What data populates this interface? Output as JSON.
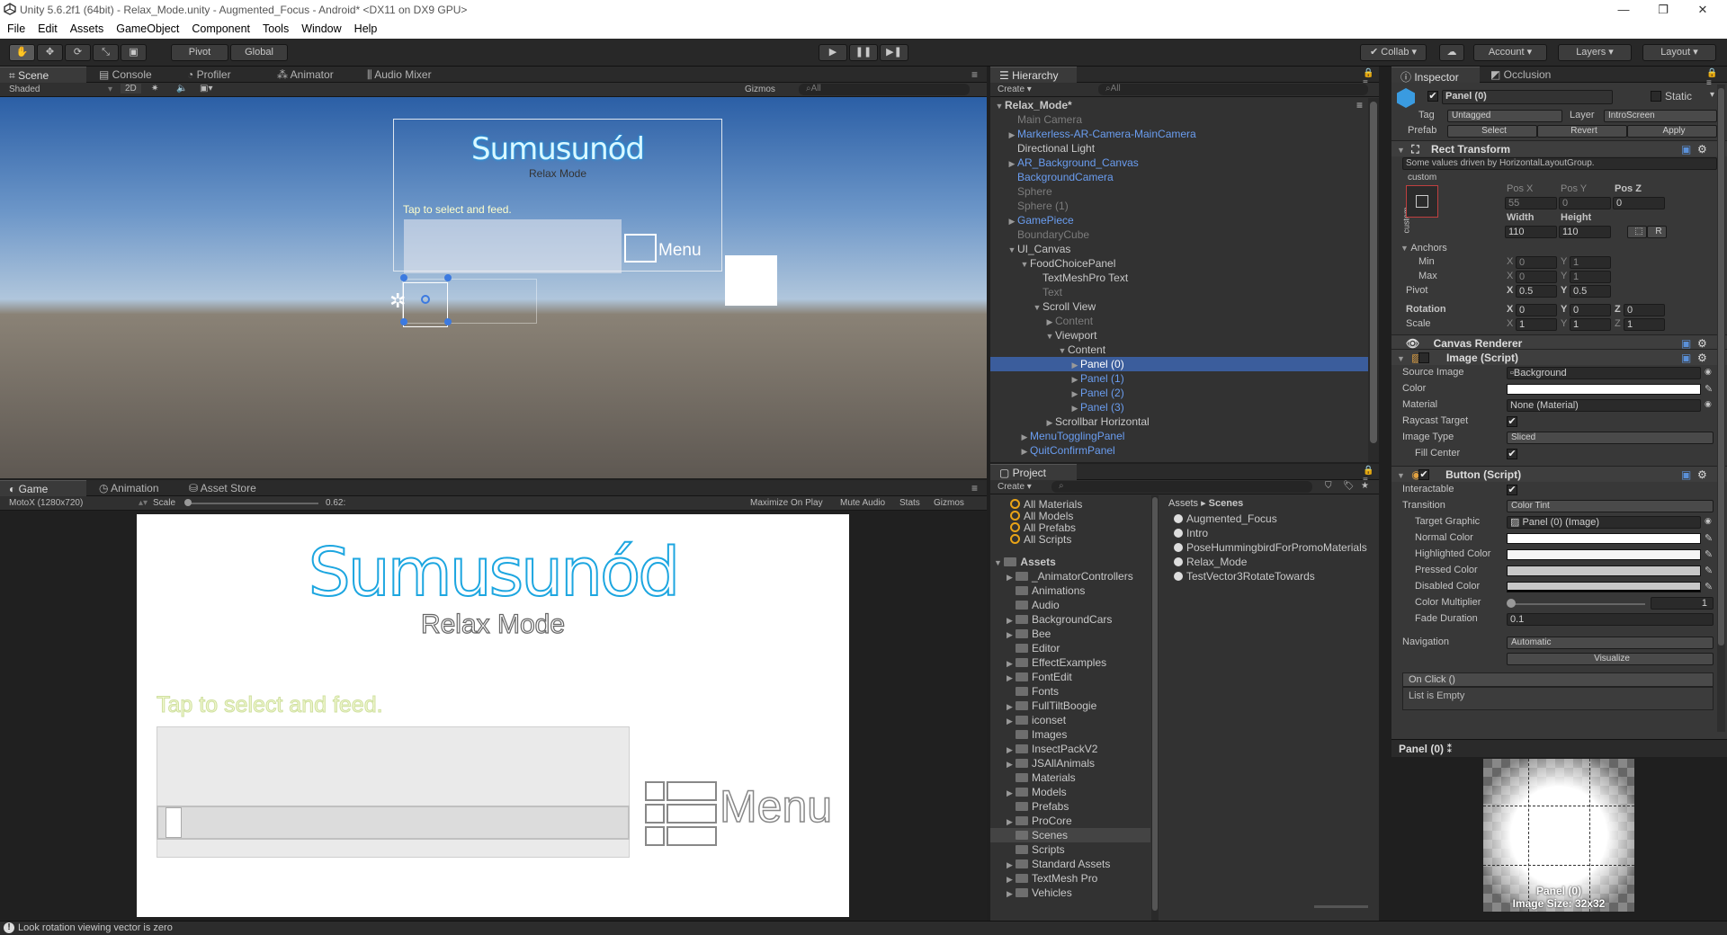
{
  "window": {
    "title": "Unity 5.6.2f1 (64bit) - Relax_Mode.unity - Augmented_Focus - Android* <DX11 on DX9 GPU>"
  },
  "menu": [
    "File",
    "Edit",
    "Assets",
    "GameObject",
    "Component",
    "Tools",
    "Window",
    "Help"
  ],
  "toolbar": {
    "pivot": "Pivot",
    "global": "Global",
    "collab": "Collab",
    "account": "Account",
    "layers": "Layers",
    "layout": "Layout"
  },
  "scene": {
    "tabs": [
      "Scene",
      "Console",
      "Profiler",
      "Animator",
      "Audio Mixer"
    ],
    "shaded": "Shaded",
    "mode2d": "2D",
    "gizmos": "Gizmos",
    "search": "All",
    "title": "Sumusunód",
    "subtitle": "Relax Mode",
    "tap": "Tap to select and feed.",
    "menu": "Menu"
  },
  "game": {
    "tabs": [
      "Game",
      "Animation",
      "Asset Store"
    ],
    "display": "MotoX (1280x720)",
    "scale_label": "Scale",
    "scale_value": "0.62:",
    "options": [
      "Maximize On Play",
      "Mute Audio",
      "Stats",
      "Gizmos"
    ],
    "title": "Sumusunód",
    "subtitle": "Relax Mode",
    "tap": "Tap to select and feed.",
    "menu": "Menu"
  },
  "hierarchy": {
    "tab": "Hierarchy",
    "create": "Create",
    "search": "All",
    "rows": [
      {
        "t": "Relax_Mode*",
        "d": 0,
        "a": "▼",
        "c": "root"
      },
      {
        "t": "Main Camera",
        "d": 1,
        "a": "",
        "c": "gray"
      },
      {
        "t": "Markerless-AR-Camera-MainCamera",
        "d": 1,
        "a": "▶",
        "c": "blue"
      },
      {
        "t": "Directional Light",
        "d": 1,
        "a": "",
        "c": ""
      },
      {
        "t": "AR_Background_Canvas",
        "d": 1,
        "a": "▶",
        "c": "blue"
      },
      {
        "t": "BackgroundCamera",
        "d": 1,
        "a": "",
        "c": "blue"
      },
      {
        "t": "Sphere",
        "d": 1,
        "a": "",
        "c": "gray"
      },
      {
        "t": "Sphere (1)",
        "d": 1,
        "a": "",
        "c": "gray"
      },
      {
        "t": "GamePiece",
        "d": 1,
        "a": "▶",
        "c": "blue"
      },
      {
        "t": "BoundaryCube",
        "d": 1,
        "a": "",
        "c": "gray"
      },
      {
        "t": "UI_Canvas",
        "d": 1,
        "a": "▼",
        "c": ""
      },
      {
        "t": "FoodChoicePanel",
        "d": 2,
        "a": "▼",
        "c": ""
      },
      {
        "t": "TextMeshPro Text",
        "d": 3,
        "a": "",
        "c": ""
      },
      {
        "t": "Text",
        "d": 3,
        "a": "",
        "c": "gray"
      },
      {
        "t": "Scroll View",
        "d": 3,
        "a": "▼",
        "c": ""
      },
      {
        "t": "Content",
        "d": 4,
        "a": "▶",
        "c": "gray"
      },
      {
        "t": "Viewport",
        "d": 4,
        "a": "▼",
        "c": ""
      },
      {
        "t": "Content",
        "d": 5,
        "a": "▼",
        "c": ""
      },
      {
        "t": "Panel (0)",
        "d": 6,
        "a": "▶",
        "c": "sel"
      },
      {
        "t": "Panel (1)",
        "d": 6,
        "a": "▶",
        "c": "blue"
      },
      {
        "t": "Panel (2)",
        "d": 6,
        "a": "▶",
        "c": "blue"
      },
      {
        "t": "Panel (3)",
        "d": 6,
        "a": "▶",
        "c": "blue"
      },
      {
        "t": "Scrollbar Horizontal",
        "d": 4,
        "a": "▶",
        "c": ""
      },
      {
        "t": "MenuTogglingPanel",
        "d": 2,
        "a": "▶",
        "c": "blue"
      },
      {
        "t": "QuitConfirmPanel",
        "d": 2,
        "a": "▶",
        "c": "blue"
      }
    ]
  },
  "project": {
    "tab": "Project",
    "create": "Create",
    "favorites": [
      "All Materials",
      "All Models",
      "All Prefabs",
      "All Scripts"
    ],
    "assets_label": "Assets",
    "folders": [
      "_AnimatorControllers",
      "Animations",
      "Audio",
      "BackgroundCars",
      "Bee",
      "Editor",
      "EffectExamples",
      "FontEdit",
      "Fonts",
      "FullTiltBoogie",
      "iconset",
      "Images",
      "InsectPackV2",
      "JSAllAnimals",
      "Materials",
      "Models",
      "Prefabs",
      "ProCore",
      "Scenes",
      "Scripts",
      "Standard Assets",
      "TextMesh Pro",
      "Vehicles"
    ],
    "breadcrumb": [
      "Assets",
      "Scenes"
    ],
    "files": [
      "Augmented_Focus",
      "Intro",
      "PoseHummingbirdForPromoMaterials",
      "Relax_Mode",
      "TestVector3RotateTowards"
    ]
  },
  "inspector": {
    "tabs": [
      "Inspector",
      "Occlusion"
    ],
    "object": "Panel (0)",
    "static": "Static",
    "tag_label": "Tag",
    "tag": "Untagged",
    "layer_label": "Layer",
    "layer": "IntroScreen",
    "prefab_label": "Prefab",
    "prefab_btns": [
      "Select",
      "Revert",
      "Apply"
    ],
    "rect_title": "Rect Transform",
    "rect_note": "Some values driven by HorizontalLayoutGroup.",
    "custom": "custom",
    "posx_l": "Pos X",
    "posy_l": "Pos Y",
    "posz_l": "Pos Z",
    "posx": "55",
    "posy": "0",
    "posz": "0",
    "width_l": "Width",
    "height_l": "Height",
    "width": "110",
    "height": "110",
    "r": "R",
    "anchors": "Anchors",
    "min": "Min",
    "max": "Max",
    "pivot": "Pivot",
    "amin_x": "0",
    "amin_y": "1",
    "amax_x": "0",
    "amax_y": "1",
    "pivot_x": "0.5",
    "pivot_y": "0.5",
    "rotation": "Rotation",
    "scale": "Scale",
    "rot": [
      "0",
      "0",
      "0"
    ],
    "scl": [
      "1",
      "1",
      "1"
    ],
    "canvas_renderer": "Canvas Renderer",
    "image_script": "Image (Script)",
    "source_image_l": "Source Image",
    "source_image": "Background",
    "color_l": "Color",
    "material_l": "Material",
    "material": "None (Material)",
    "raycast_l": "Raycast Target",
    "image_type_l": "Image Type",
    "image_type": "Sliced",
    "fill_center_l": "Fill Center",
    "button_script": "Button (Script)",
    "interactable_l": "Interactable",
    "transition_l": "Transition",
    "transition": "Color Tint",
    "target_graphic_l": "Target Graphic",
    "target_graphic": "Panel (0) (Image)",
    "normal_l": "Normal Color",
    "highlighted_l": "Highlighted Color",
    "pressed_l": "Pressed Color",
    "disabled_l": "Disabled Color",
    "multiplier_l": "Color Multiplier",
    "multiplier": "1",
    "fade_l": "Fade Duration",
    "fade": "0.1",
    "navigation_l": "Navigation",
    "navigation": "Automatic",
    "visualize": "Visualize",
    "onclick": "On Click ()",
    "list_empty": "List is Empty",
    "preview_title": "Panel (0)",
    "preview_name": "Panel (0)",
    "preview_size": "Image Size: 32x32"
  },
  "status": {
    "message": "Look rotation viewing vector is zero"
  }
}
